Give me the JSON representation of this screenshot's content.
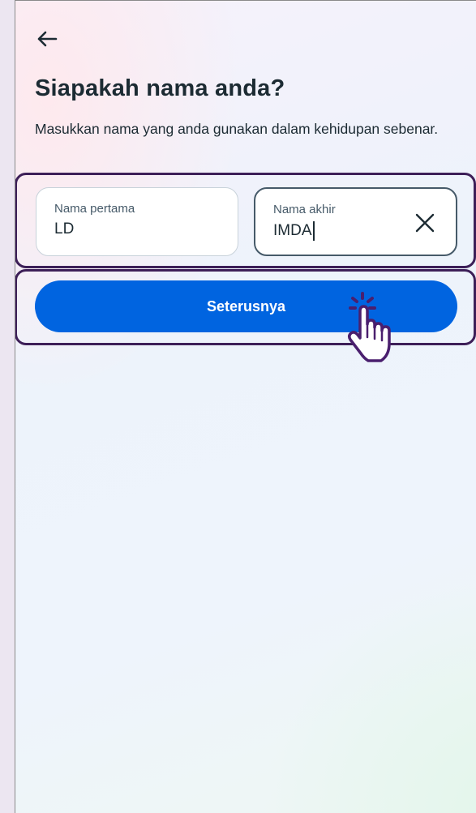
{
  "header": {
    "back_icon": "arrow-left-icon"
  },
  "page": {
    "title": "Siapakah nama anda?",
    "subtitle": "Masukkan nama yang anda gunakan dalam kehidupan sebenar."
  },
  "form": {
    "first_name": {
      "label": "Nama pertama",
      "value": "LD"
    },
    "last_name": {
      "label": "Nama akhir",
      "value": "IMDA",
      "focused": true,
      "clear_icon": "close-icon"
    }
  },
  "actions": {
    "next_label": "Seterusnya",
    "next_color": "#0064e0"
  },
  "overlay": {
    "cursor_icon": "hand-pointer-click-icon",
    "highlight_color": "#3d1f58"
  }
}
